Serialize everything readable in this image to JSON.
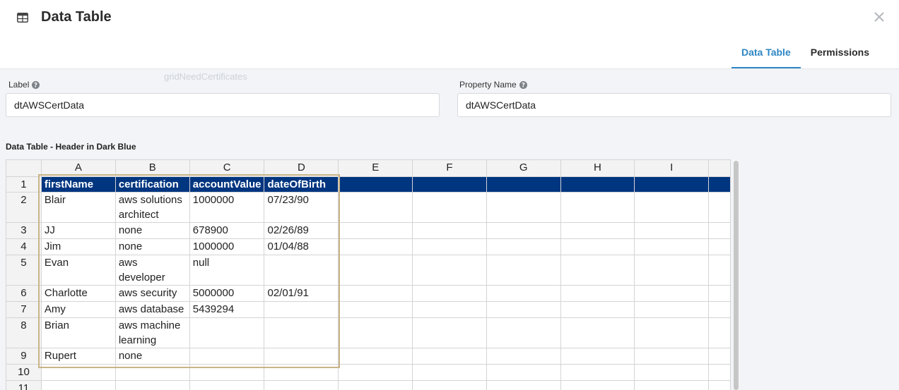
{
  "header": {
    "title": "Data Table",
    "icon": "table-icon",
    "close_icon": "close-icon"
  },
  "tabs": [
    {
      "label": "Data Table",
      "active": true
    },
    {
      "label": "Permissions",
      "active": false
    }
  ],
  "background_text": "gridNeedCertificates",
  "fields": {
    "label": {
      "label": "Label",
      "value": "dtAWSCertData"
    },
    "property_name": {
      "label": "Property Name",
      "value": "dtAWSCertData"
    }
  },
  "section_title": "Data Table - Header in Dark Blue",
  "grid": {
    "columns": [
      "A",
      "B",
      "C",
      "D",
      "E",
      "F",
      "G",
      "H",
      "I"
    ],
    "row_numbers": [
      "1",
      "2",
      "3",
      "4",
      "5",
      "6",
      "7",
      "8",
      "9",
      "10",
      "11"
    ],
    "rows": [
      [
        "firstName",
        "certification",
        "accountValue",
        "dateOfBirth",
        "",
        "",
        "",
        "",
        ""
      ],
      [
        "Blair",
        "aws solutions architect",
        "1000000",
        "07/23/90",
        "",
        "",
        "",
        "",
        ""
      ],
      [
        "JJ",
        "none",
        "678900",
        "02/26/89",
        "",
        "",
        "",
        "",
        ""
      ],
      [
        "Jim",
        "none",
        "1000000",
        "01/04/88",
        "",
        "",
        "",
        "",
        ""
      ],
      [
        "Evan",
        "aws developer",
        "null",
        "",
        "",
        "",
        "",
        "",
        ""
      ],
      [
        "Charlotte",
        "aws security",
        "5000000",
        "02/01/91",
        "",
        "",
        "",
        "",
        ""
      ],
      [
        "Amy",
        "aws database",
        "5439294",
        "",
        "",
        "",
        "",
        "",
        ""
      ],
      [
        "Brian",
        "aws machine learning",
        "",
        "",
        "",
        "",
        "",
        "",
        ""
      ],
      [
        "Rupert",
        "none",
        "",
        "",
        "",
        "",
        "",
        "",
        ""
      ],
      [
        "",
        "",
        "",
        "",
        "",
        "",
        "",
        "",
        ""
      ],
      [
        "",
        "",
        "",
        "",
        "",
        "",
        "",
        "",
        ""
      ]
    ]
  },
  "colors": {
    "header_row_bg": "#003580",
    "accent": "#2f86c3",
    "selection_border": "#c9b488"
  }
}
